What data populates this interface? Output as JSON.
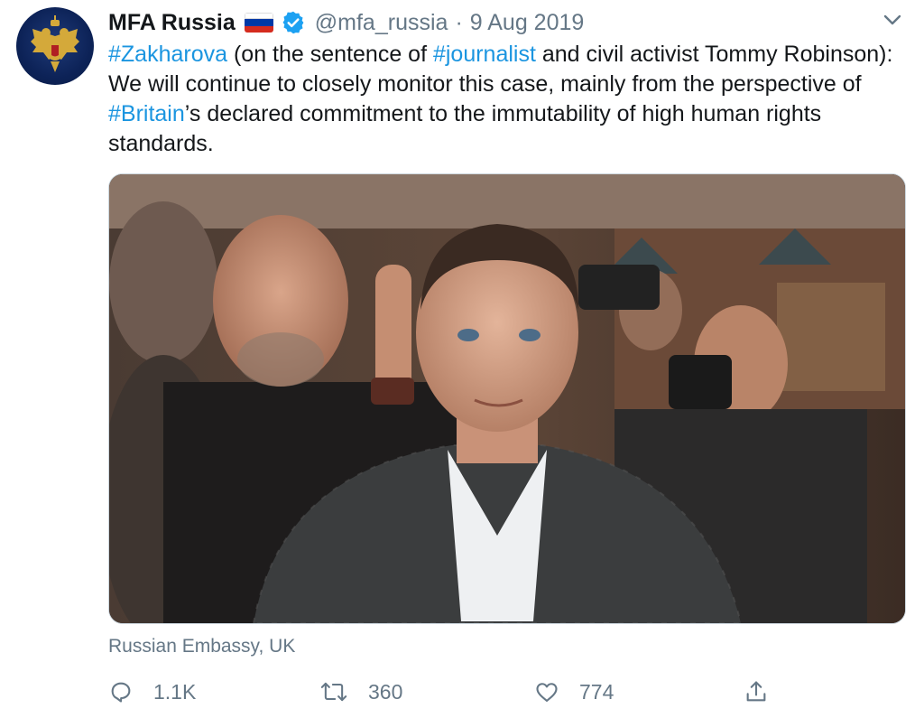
{
  "tweet": {
    "display_name": "MFA Russia",
    "handle": "@mfa_russia",
    "separator": "·",
    "date": "9 Aug 2019",
    "text_segments": [
      {
        "text": "#Zakharova",
        "type": "hashtag"
      },
      {
        "text": " (on the sentence of ",
        "type": "text"
      },
      {
        "text": "#journalist",
        "type": "hashtag"
      },
      {
        "text": " and civil activist Tommy Robinson): We will continue to closely monitor this case, mainly from the perspective of ",
        "type": "text"
      },
      {
        "text": "#Britain",
        "type": "hashtag"
      },
      {
        "text": "’s declared commitment to the immutability of high human rights standards.",
        "type": "text"
      }
    ],
    "location": "Russian Embassy, UK",
    "stats": {
      "replies": "1.1K",
      "retweets": "360",
      "likes": "774"
    }
  },
  "icons": {
    "avatar": "russian-coat-of-arms",
    "flag": "russia-flag",
    "verified": "verified-badge-icon",
    "menu": "chevron-down-icon",
    "reply": "reply-icon",
    "retweet": "retweet-icon",
    "like": "heart-icon",
    "share": "share-icon"
  },
  "colors": {
    "link": "#1b95e0",
    "secondary_text": "#657786",
    "verified": "#1da1f2",
    "avatar_bg": "#0d2358"
  }
}
